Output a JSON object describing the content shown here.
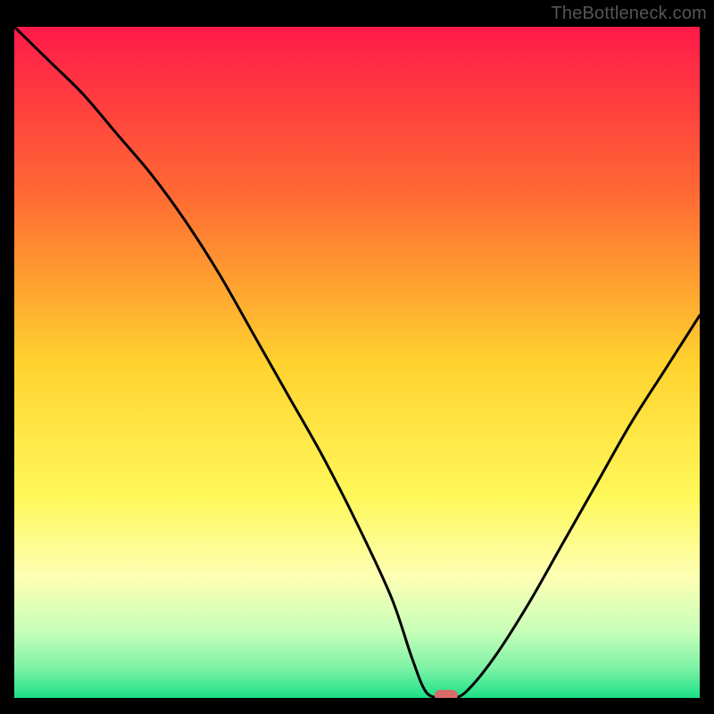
{
  "watermark": "TheBottleneck.com",
  "chart_data": {
    "type": "line",
    "title": "",
    "xlabel": "",
    "ylabel": "",
    "xlim": [
      0,
      100
    ],
    "ylim": [
      0,
      100
    ],
    "background": {
      "type": "vertical-gradient",
      "stops": [
        {
          "offset": 0.0,
          "color": "#ff1a4a"
        },
        {
          "offset": 0.25,
          "color": "#ff6a33"
        },
        {
          "offset": 0.5,
          "color": "#ffd22e"
        },
        {
          "offset": 0.7,
          "color": "#fff85a"
        },
        {
          "offset": 0.82,
          "color": "#fdffb4"
        },
        {
          "offset": 0.9,
          "color": "#c8ffb9"
        },
        {
          "offset": 0.955,
          "color": "#7ef2a6"
        },
        {
          "offset": 1.0,
          "color": "#1be087"
        }
      ]
    },
    "series": [
      {
        "name": "bottleneck-curve",
        "color": "#000000",
        "x": [
          0,
          5,
          10,
          15,
          20,
          25,
          30,
          35,
          40,
          45,
          50,
          55,
          58,
          60,
          62,
          64,
          66,
          70,
          75,
          80,
          85,
          90,
          95,
          100
        ],
        "y": [
          100,
          95,
          90,
          84,
          78,
          71,
          63,
          54,
          45,
          36,
          26,
          15,
          6,
          1,
          0,
          0,
          1,
          6,
          14,
          23,
          32,
          41,
          49,
          57
        ]
      }
    ],
    "marker": {
      "name": "optimal-point",
      "shape": "pill",
      "cx": 63,
      "cy": 0,
      "color": "#d86a6a"
    }
  }
}
